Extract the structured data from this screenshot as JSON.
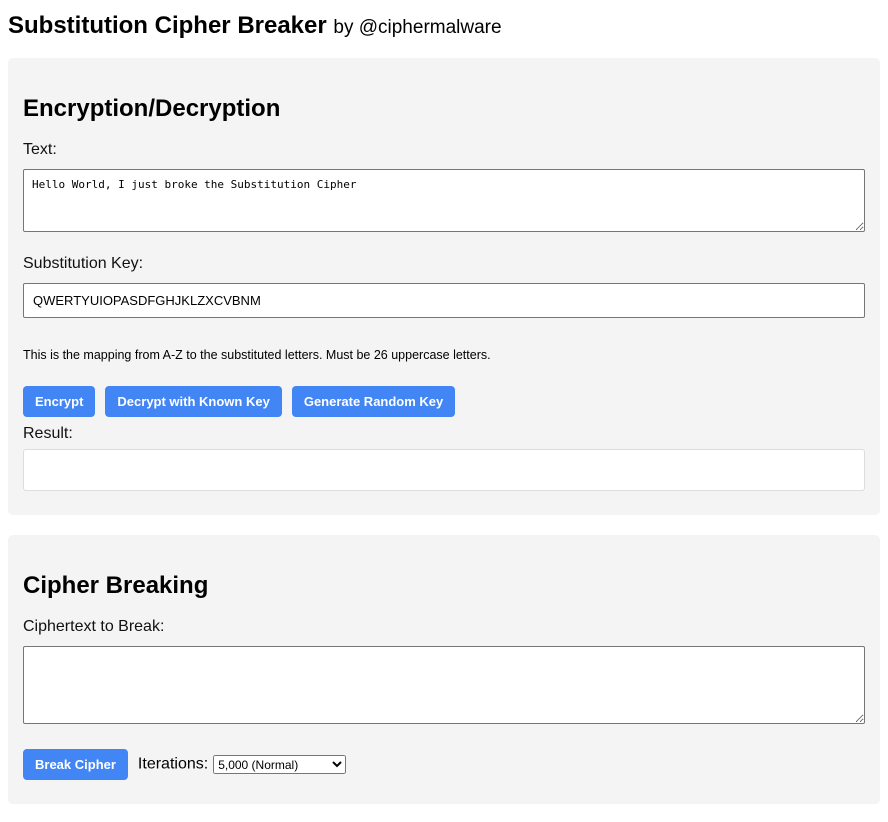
{
  "header": {
    "title": "Substitution Cipher Breaker",
    "byline": "by @ciphermalware"
  },
  "encryption": {
    "heading": "Encryption/Decryption",
    "text_label": "Text:",
    "text_value": "Hello World, I just broke the Substitution Cipher",
    "key_label": "Substitution Key:",
    "key_value": "QWERTYUIOPASDFGHJKLZXCVBNM",
    "help": "This is the mapping from A-Z to the substituted letters. Must be 26 uppercase letters.",
    "encrypt_label": "Encrypt",
    "decrypt_label": "Decrypt with Known Key",
    "generate_label": "Generate Random Key",
    "result_label": "Result:",
    "result_value": ""
  },
  "breaking": {
    "heading": "Cipher Breaking",
    "ciphertext_label": "Ciphertext to Break:",
    "ciphertext_value": "",
    "break_label": "Break Cipher",
    "iterations_label": "Iterations:",
    "iterations_selected": "5,000 (Normal)"
  },
  "colors": {
    "accent": "#4285f4",
    "panel": "#f4f4f4"
  }
}
